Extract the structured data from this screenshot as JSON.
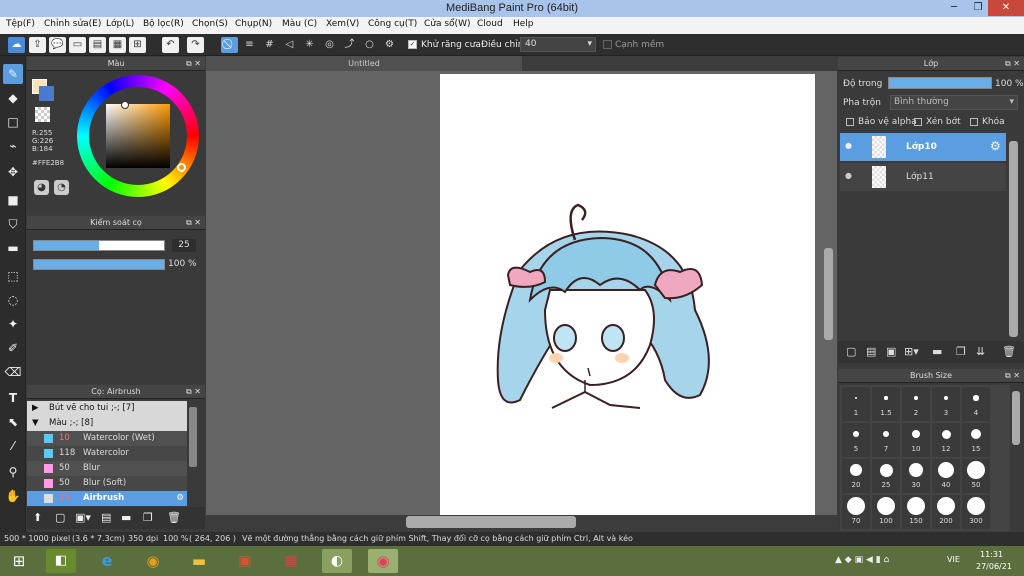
{
  "window": {
    "title": "MediBang Paint Pro (64bit)"
  },
  "menu": [
    "Tệp(F)",
    "Chỉnh sửa(E)",
    "Lớp(L)",
    "Bộ lọc(R)",
    "Chọn(S)",
    "Chụp(N)",
    "Màu (C)",
    "Xem(V)",
    "Công cụ(T)",
    "Cửa sổ(W)",
    "Cloud",
    "Help"
  ],
  "toolbar": {
    "antialias_label": "Khử răng cưa",
    "adjust_label": "Điều chỉnh",
    "adjust_value": "40",
    "edge_label": "Cạnh mềm"
  },
  "color_panel": {
    "title": "Màu",
    "r": "R:255",
    "g": "G:226",
    "b": "B:184",
    "hex": "#FFE2B8",
    "primary_color": "#ffe2b8",
    "secondary_color": "#4a7ad0"
  },
  "brush_control": {
    "title": "Kiểm soát cọ",
    "size_value": "25",
    "size_fraction": 0.5,
    "opacity_value": "100 %",
    "opacity_fraction": 1.0
  },
  "brush_list": {
    "title": "Cọ: Airbrush",
    "groups": [
      {
        "label": "Bút vẽ cho tui ;-; [7]",
        "expanded": false
      },
      {
        "label": "Màu ;-; [8]",
        "expanded": true
      }
    ],
    "items": [
      {
        "size": "10",
        "name": "Watercolor (Wet)",
        "color": "#5ec8f0",
        "size_color": "#ff7070",
        "selected": false
      },
      {
        "size": "118",
        "name": "Watercolor",
        "color": "#5ec8f0",
        "size_color": "#dddddd",
        "selected": false
      },
      {
        "size": "50",
        "name": "Blur",
        "color": "#ff9ae6",
        "size_color": "#dddddd",
        "selected": false
      },
      {
        "size": "50",
        "name": "Blur (Soft)",
        "color": "#ff9ae6",
        "size_color": "#dddddd",
        "selected": false
      },
      {
        "size": "25",
        "name": "Airbrush",
        "color": "#dddddd",
        "size_color": "#ff7070",
        "selected": true
      }
    ]
  },
  "document": {
    "tab": "Untitled"
  },
  "layer_panel": {
    "title": "Lớp",
    "opacity_label": "Độ trong",
    "opacity_value": "100 %",
    "blend_label": "Pha trộn",
    "blend_value": "Bình thường",
    "protect_alpha": "Bảo vệ alpha",
    "clipping": "Xén bớt",
    "lock": "Khóa",
    "layers": [
      {
        "name": "Lớp10",
        "selected": true
      },
      {
        "name": "Lớp11",
        "selected": false
      }
    ]
  },
  "brush_size": {
    "title": "Brush Size",
    "sizes": [
      "1",
      "1.5",
      "2",
      "3",
      "4",
      "5",
      "7",
      "10",
      "12",
      "15",
      "20",
      "25",
      "30",
      "40",
      "50",
      "70",
      "100",
      "150",
      "200",
      "300"
    ]
  },
  "status": {
    "size": "500 * 1000 pixel",
    "cm": "(3.6 * 7.3cm)",
    "dpi": "350 dpi",
    "zoom": "100 %",
    "coords": "( 264, 206 )",
    "hint": "Vẽ một đường thẳng bằng cách giữ phím Shift, Thay đổi cỡ cọ bằng cách giữ phím Ctrl, Alt và kéo"
  },
  "taskbar": {
    "lang": "VIE",
    "time": "11:31",
    "date": "27/06/21"
  }
}
